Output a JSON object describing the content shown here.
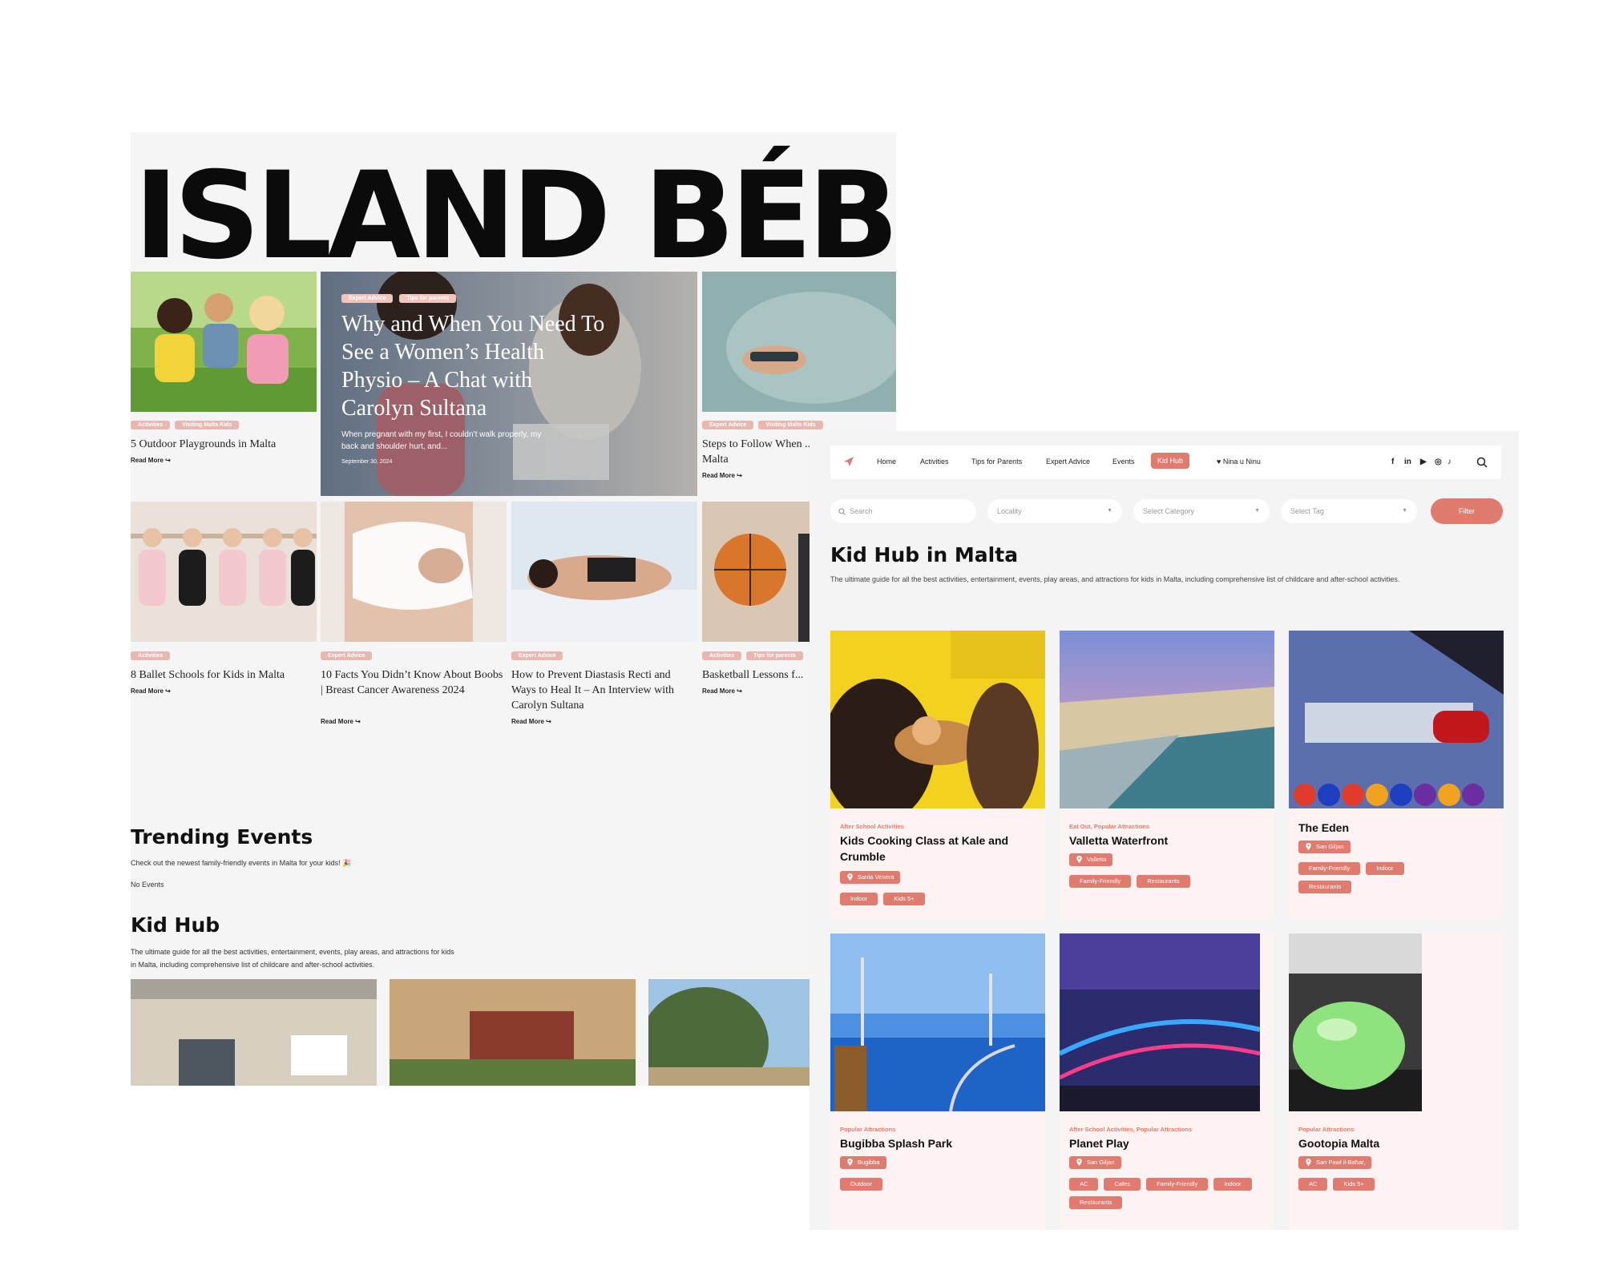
{
  "home": {
    "brand": "ISLAND BÉBÉ",
    "read_more": "Read More",
    "hero": {
      "tags": [
        "Expert Advice",
        "Tips for parents"
      ],
      "title": "Why and When You Need To See a Women’s Health Physio – A Chat with Carolyn Sultana",
      "excerpt": "When pregnant with my first, I couldn’t walk properly, my back and shoulder hurt, and...",
      "date": "September 30, 2024"
    },
    "posts": [
      {
        "tags": [
          "Activities",
          "Visiting Malta Kids"
        ],
        "title": "5 Outdoor Playgrounds in Malta"
      },
      {
        "tags": [
          "Expert Advice",
          "Visiting Malta Kids"
        ],
        "title": "Steps to Follow When ... Malta"
      },
      {
        "tags": [
          "Activities"
        ],
        "title": "8 Ballet Schools for Kids in Malta"
      },
      {
        "tags": [
          "Expert Advice"
        ],
        "title": "10 Facts You Didn’t Know About Boobs | Breast Cancer Awareness 2024"
      },
      {
        "tags": [
          "Expert Advice"
        ],
        "title": "How to Prevent Diastasis Recti and Ways to Heal It – An Interview with Carolyn Sultana"
      },
      {
        "tags": [
          "Activities",
          "Tips for parents"
        ],
        "title": "Basketball Lessons f..."
      }
    ],
    "trending": {
      "heading": "Trending Events",
      "subtitle": "Check out the newest family-friendly events in Malta for your kids! 🎉",
      "empty": "No Events"
    },
    "kidhub": {
      "heading": "Kid Hub",
      "desc_1": "The ultimate guide for all the best activities, entertainment, events, play areas, and attractions for kids",
      "desc_2": "in Malta, including comprehensive list of childcare and after-school activities."
    }
  },
  "hub": {
    "nav": {
      "items": [
        "Home",
        "Activities",
        "Tips for Parents",
        "Expert Advice",
        "Events",
        "Kid Hub"
      ],
      "active": "Kid Hub",
      "heart_link": "Nina u Ninu",
      "social_icons": [
        "facebook-icon",
        "linkedin-icon",
        "youtube-icon",
        "instagram-icon",
        "tiktok-icon"
      ]
    },
    "filters": {
      "search_placeholder": "Search",
      "locality": "Locality",
      "category": "Select Category",
      "tag": "Select Tag",
      "button": "Filter"
    },
    "title": "Kid Hub in Malta",
    "description": "The ultimate guide for all the best activities, entertainment, events, play areas, and attractions for kids in Malta, including comprehensive list of childcare and after-school activities.",
    "cards": [
      {
        "category": "After School Activities",
        "name": "Kids Cooking Class at Kale and Crumble",
        "location": "Santa Venera",
        "tags": [
          "Indoor",
          "Kids 5+"
        ]
      },
      {
        "category": "Eat Out, Popular Attractions",
        "name": "Valletta Waterfront",
        "location": "Valletta",
        "tags": [
          "Family-Friendly",
          "Restaurants"
        ]
      },
      {
        "category": "",
        "name": "The Eden",
        "location": "San Giljan",
        "tags": [
          "Family-Friendly",
          "Indoor",
          "Restaurants"
        ]
      },
      {
        "category": "Popular Attractions",
        "name": "Bugibba Splash Park",
        "location": "Bugibba",
        "tags": [
          "Outdoor"
        ]
      },
      {
        "category": "After School Activities, Popular Attractions",
        "name": "Planet Play",
        "location": "San Giljan",
        "tags": [
          "AC",
          "Cafes",
          "Family-Friendly",
          "Indoor",
          "Restaurants"
        ]
      },
      {
        "category": "Popular Attractions",
        "name": "Gootopia Malta",
        "location": "San Pawl il-Baħar,",
        "tags": [
          "AC",
          "Kids 5+"
        ]
      }
    ]
  },
  "colors": {
    "accent": "#e07b6f",
    "tag_pink": "#e9b6b0",
    "card_bg": "#fcf3f2",
    "page_bg": "#f4f4f4"
  }
}
